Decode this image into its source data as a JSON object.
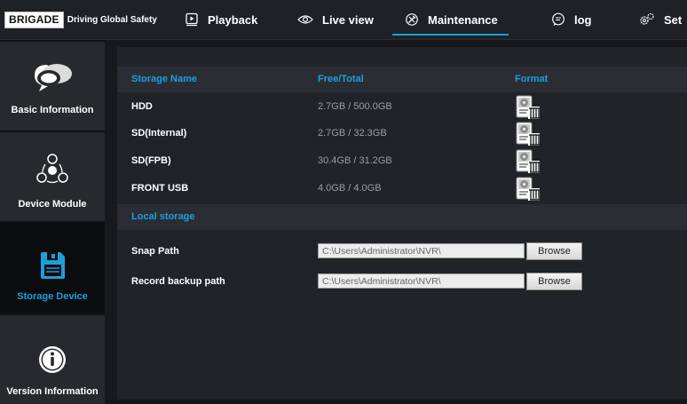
{
  "header": {
    "logo": "BRIGADE",
    "tagline": "Driving Global Safety",
    "nav": [
      {
        "label": "Playback",
        "icon": "playback-icon"
      },
      {
        "label": "Live view",
        "icon": "eye-icon"
      },
      {
        "label": "Maintenance",
        "icon": "wrench-icon",
        "active": true
      },
      {
        "label": "log",
        "icon": "log-icon"
      },
      {
        "label": "Set",
        "icon": "gear-icon"
      }
    ],
    "active_color": "#16a0dc"
  },
  "sidebar": {
    "items": [
      {
        "label": "Basic Information",
        "icon": "speech-bubble-icon"
      },
      {
        "label": "Device Module",
        "icon": "module-icon"
      },
      {
        "label": "Storage Device",
        "icon": "floppy-disk-icon",
        "active": true
      },
      {
        "label": "Version Information",
        "icon": "info-icon"
      }
    ]
  },
  "storage_table": {
    "headers": {
      "name": "Storage Name",
      "free_total": "Free/Total",
      "format": "Format"
    },
    "rows": [
      {
        "name": "HDD",
        "free_total": "2.7GB / 500.0GB"
      },
      {
        "name": "SD(Internal)",
        "free_total": "2.7GB / 32.3GB"
      },
      {
        "name": "SD(FPB)",
        "free_total": "30.4GB / 31.2GB"
      },
      {
        "name": "FRONT USB",
        "free_total": "4.0GB / 4.0GB"
      }
    ],
    "format_icon": "disk-format-icon"
  },
  "local_storage": {
    "title": "Local storage",
    "snap_path": {
      "label": "Snap Path",
      "value": "C:\\Users\\Administrator\\NVR\\",
      "button": "Browse"
    },
    "record_backup_path": {
      "label": "Record backup path",
      "value": "C:\\Users\\Administrator\\NVR\\",
      "button": "Browse"
    }
  }
}
